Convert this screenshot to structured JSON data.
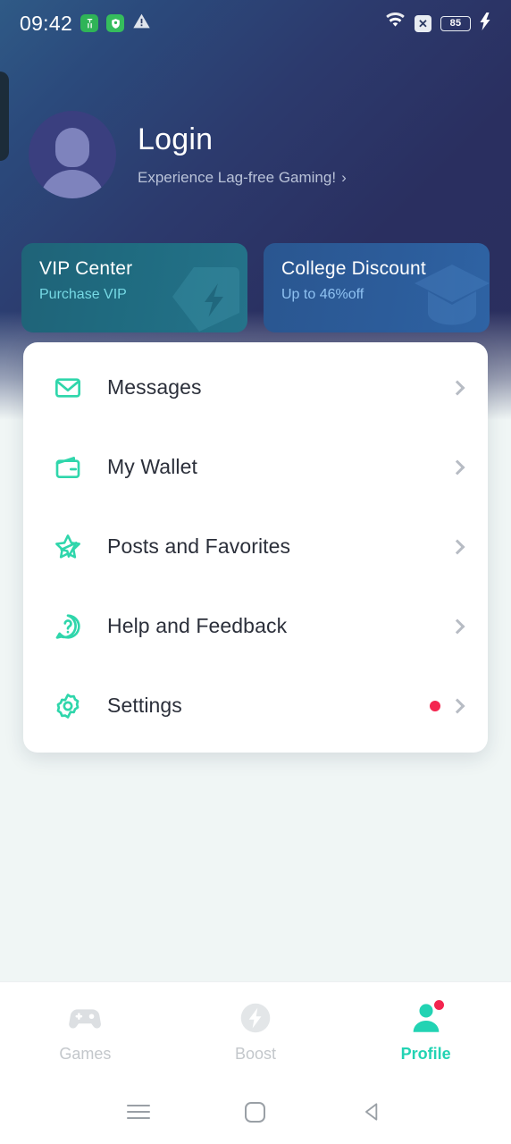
{
  "statusbar": {
    "time": "09:42",
    "battery_level": "85",
    "icons": [
      "green-app-icon",
      "green-shield-icon",
      "warning-triangle-icon",
      "wifi-icon",
      "no-sim-icon",
      "battery-icon",
      "charging-bolt-icon"
    ],
    "nosim_glyph": "✕"
  },
  "profile_header": {
    "title": "Login",
    "subtitle": "Experience Lag-free Gaming!",
    "chevron": "›"
  },
  "promos": [
    {
      "title": "VIP Center",
      "subtitle": "Purchase VIP",
      "art": "diamond-bolt-icon"
    },
    {
      "title": "College Discount",
      "subtitle": "Up to 46%off",
      "art": "graduation-cap-icon"
    }
  ],
  "menu": [
    {
      "label": "Messages",
      "icon": "envelope-icon",
      "badge": false
    },
    {
      "label": "My Wallet",
      "icon": "wallet-icon",
      "badge": false
    },
    {
      "label": "Posts and Favorites",
      "icon": "star-plane-icon",
      "badge": false
    },
    {
      "label": "Help and Feedback",
      "icon": "question-bubble-icon",
      "badge": false
    },
    {
      "label": "Settings",
      "icon": "gear-icon",
      "badge": true
    }
  ],
  "tabbar": [
    {
      "label": "Games",
      "icon": "gamepad-icon",
      "active": false,
      "badge": false
    },
    {
      "label": "Boost",
      "icon": "bolt-circle-icon",
      "active": false,
      "badge": false
    },
    {
      "label": "Profile",
      "icon": "person-icon",
      "active": true,
      "badge": true
    }
  ],
  "navbar": [
    "recents-icon",
    "home-icon",
    "back-icon"
  ],
  "colors": {
    "accent_teal": "#22d3b3",
    "badge_red": "#f4254f",
    "header_blue": "#2b2f5e",
    "page_bg": "#f0f6f5"
  }
}
